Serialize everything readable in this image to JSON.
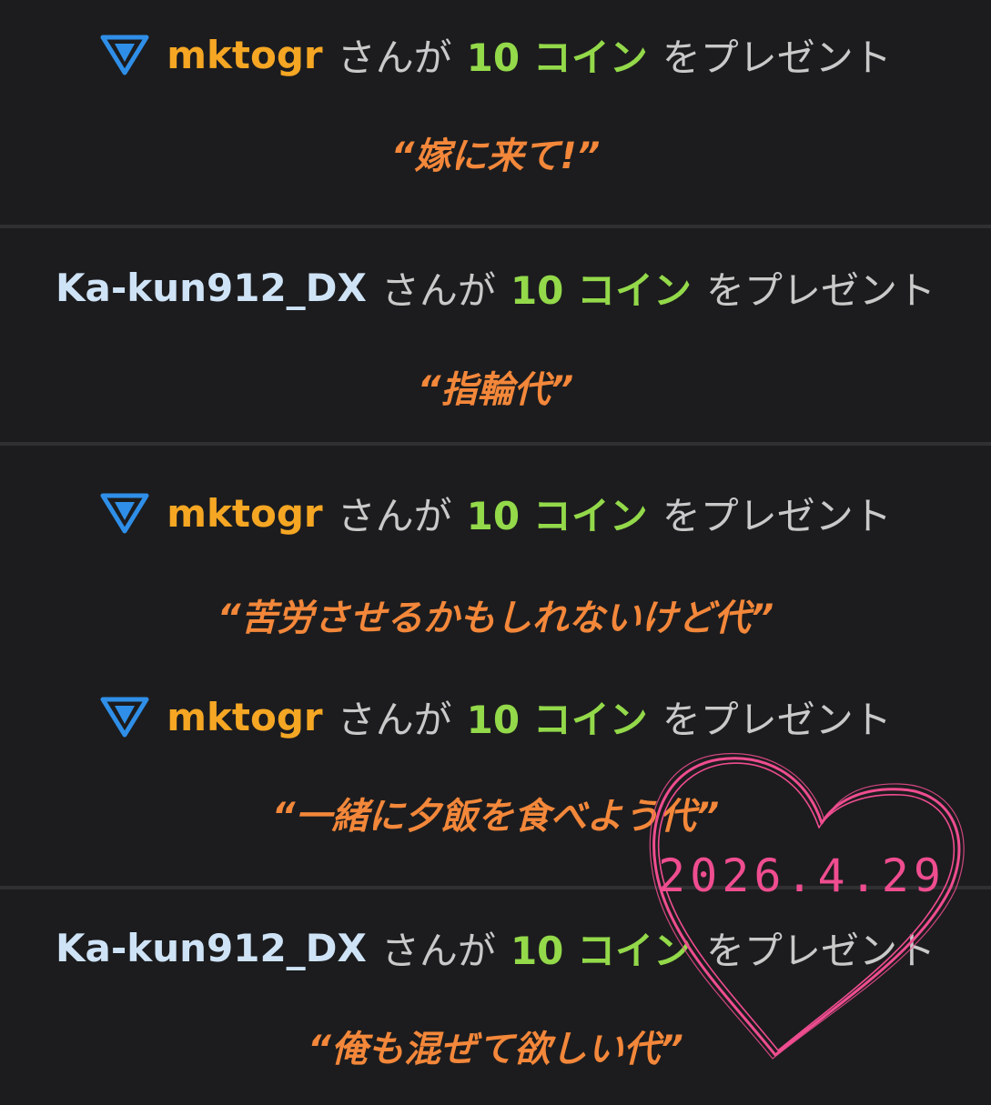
{
  "feed": {
    "items": [
      {
        "username": "mktogr",
        "badge_icon": "blue-triangle-badge-icon",
        "san": "さんが",
        "coins": "10 コイン",
        "gift": "をプレゼント",
        "message": "“嫁に来て!”"
      },
      {
        "username": "Ka-kun912_DX",
        "san": "さんが",
        "coins": "10 コイン",
        "gift": "をプレゼント",
        "message": "“指輪代”"
      },
      {
        "username": "mktogr",
        "badge_icon": "blue-triangle-badge-icon",
        "san": "さんが",
        "coins": "10 コイン",
        "gift": "をプレゼント",
        "message": "“苦労させるかもしれないけど代”"
      },
      {
        "username": "mktogr",
        "badge_icon": "blue-triangle-badge-icon",
        "san": "さんが",
        "coins": "10 コイン",
        "gift": "をプレゼント",
        "message": "“一緒に夕飯を食べよう代”"
      },
      {
        "username": "Ka-kun912_DX",
        "san": "さんが",
        "coins": "10 コイン",
        "gift": "をプレゼント",
        "message": "“俺も混ぜて欲しい代”"
      }
    ]
  },
  "overlay": {
    "date": "2026.4.29",
    "heart_icon": "heart-doodle-icon"
  },
  "colors": {
    "background": "#1c1c1e",
    "username_gold": "#f5a623",
    "username_light": "#cfe3f7",
    "coin_green": "#93d94a",
    "message_orange": "#f3873a",
    "badge_blue": "#2f8fe8",
    "heart_pink": "#ef4d90"
  }
}
